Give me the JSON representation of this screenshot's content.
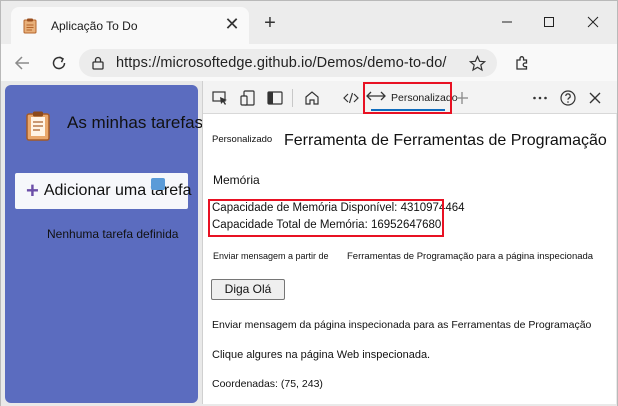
{
  "browser": {
    "tab_title": "Aplicação To Do",
    "tab_close_glyph": "✕",
    "new_tab_glyph": "+",
    "address_url": "https://microsoftedge.github.io/Demos/demo-to-do/"
  },
  "app": {
    "title": "As minhas tarefas",
    "add_plus": "+",
    "add_label": "Adicionar uma tarefa",
    "empty_text": "Nenhuma tarefa definida"
  },
  "devtools": {
    "tab_label": "Personalizado",
    "panel_small_label": "Personalizado",
    "panel_title": "Ferramenta de Ferramentas de Programação",
    "memory_heading": "Memória",
    "available_memory": "Capacidade de Memória Disponível: 4310974464",
    "total_memory": "Capacidade Total de Memória: 16952647680",
    "send_from_label": "Enviar mensagem a partir de",
    "send_from_value": "Ferramentas de Programação para a página inspecionada",
    "say_hello_button": "Diga Olá",
    "send_to_devtools": "Enviar mensagem da página inspecionada para as Ferramentas de Programação",
    "click_prompt": "Clique algures na página Web inspecionada.",
    "coordinates": "Coordenadas: (75, 243)"
  },
  "colors": {
    "app_sidebar": "#5b6cbf",
    "highlight": "#e81123",
    "accent": "#0f6cbd"
  },
  "icons": [
    "app-icon",
    "close-icon",
    "plus-icon",
    "minimize-icon",
    "maximize-icon",
    "back-icon",
    "refresh-icon",
    "lock-icon",
    "favorite-star-icon",
    "extensions-icon",
    "inspect-icon",
    "device-emulation-icon",
    "dock-icon",
    "home-icon",
    "sources-icon",
    "custom-panel-icon",
    "more-tools-icon",
    "more-options-icon",
    "help-icon"
  ]
}
